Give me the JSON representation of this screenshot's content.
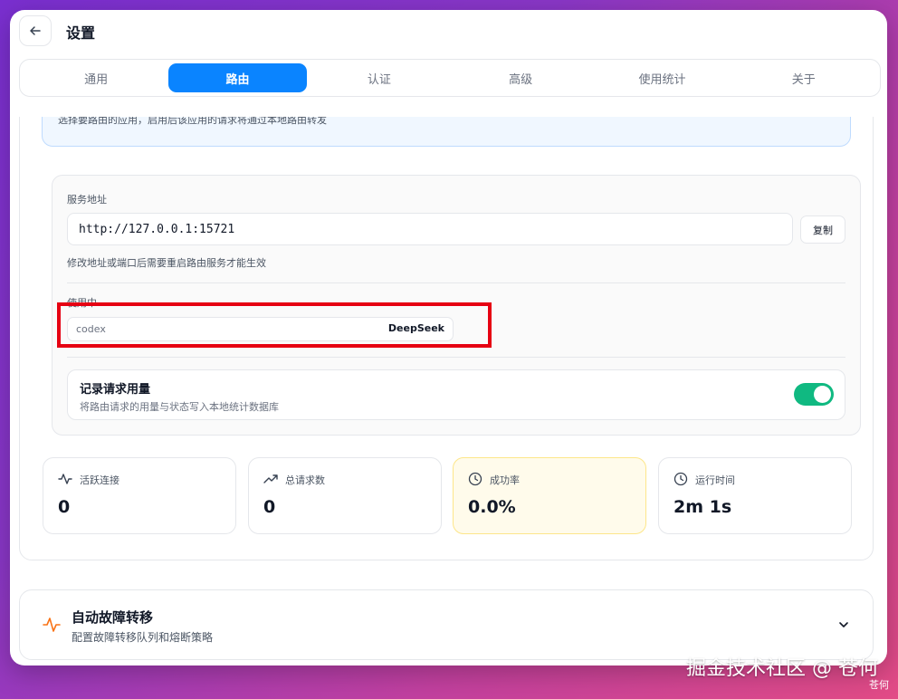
{
  "header": {
    "back_icon": "arrow-left-icon",
    "title": "设置"
  },
  "tabs": [
    {
      "label": "通用",
      "active": false
    },
    {
      "label": "路由",
      "active": true
    },
    {
      "label": "认证",
      "active": false
    },
    {
      "label": "高级",
      "active": false
    },
    {
      "label": "使用统计",
      "active": false
    },
    {
      "label": "关于",
      "active": false
    }
  ],
  "app_selection": {
    "hint": "选择要路由的应用，启用后该应用的请求将通过本地路由转发"
  },
  "service": {
    "address_label": "服务地址",
    "address_value": "http://127.0.0.1:15721",
    "copy_label": "复制",
    "address_hint": "修改地址或端口后需要重启路由服务才能生效",
    "in_use_label": "使用中",
    "in_use_app": "codex",
    "in_use_provider": "DeepSeek",
    "highlight_color": "#e60012"
  },
  "record": {
    "title": "记录请求用量",
    "description": "将路由请求的用量与状态写入本地统计数据库",
    "enabled": true,
    "toggle_color": "#10b981"
  },
  "stats": [
    {
      "icon": "activity-icon",
      "label": "活跃连接",
      "value": "0"
    },
    {
      "icon": "trending-up-icon",
      "label": "总请求数",
      "value": "0"
    },
    {
      "icon": "clock-icon",
      "label": "成功率",
      "value": "0.0%"
    },
    {
      "icon": "clock-icon",
      "label": "运行时间",
      "value": "2m 1s"
    }
  ],
  "failover": {
    "icon": "activity-icon",
    "title": "自动故障转移",
    "description": "配置故障转移队列和熔断策略",
    "chevron": "chevron-down-icon"
  },
  "watermark": {
    "text": "掘金技术社区 @ 苍何",
    "small": "苍何"
  },
  "colors": {
    "accent": "#0a84ff",
    "failover_icon": "#f97316"
  }
}
